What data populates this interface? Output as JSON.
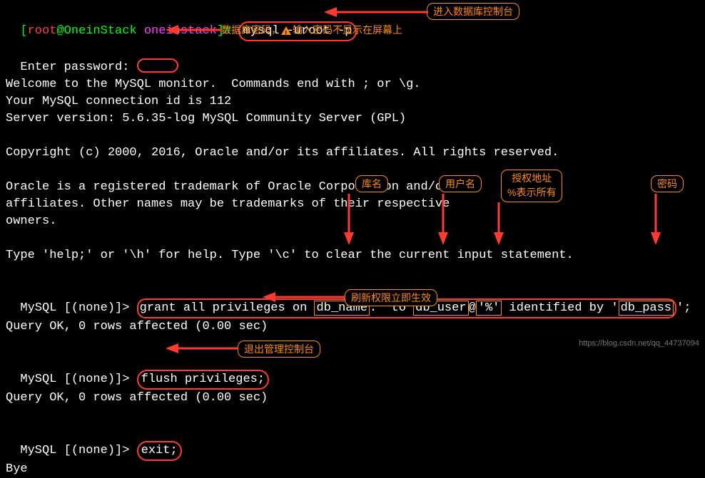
{
  "prompt": {
    "open_bracket": "[",
    "user": "root",
    "at": "@OneinStack ",
    "dir": "oneinstack",
    "close_bracket": "]# ",
    "cmd": "mysql -uroot -p"
  },
  "lines": {
    "enter_password": "Enter password:",
    "welcome": "Welcome to the MySQL monitor.  Commands end with ; or \\g.",
    "conn_id": "Your MySQL connection id is 112",
    "server_ver": "Server version: 5.6.35-log MySQL Community Server (GPL)",
    "copyright": "Copyright (c) 2000, 2016, Oracle and/or its affiliates. All rights reserved.",
    "oracle1": "Oracle is a registered trademark of Oracle Corporation and/or its",
    "oracle2": "affiliates. Other names may be trademarks of their respective",
    "oracle3": "owners.",
    "help": "Type 'help;' or '\\h' for help. Type '\\c' to clear the current input statement.",
    "queryok": "Query OK, 0 rows affected (0.00 sec)",
    "bye": "Bye"
  },
  "mysql_prompt": "MySQL [(none)]> ",
  "grant": {
    "p1": "grant all privileges on ",
    "dbname": "db_name",
    "p2": ".* to ",
    "dbuser": "db_user",
    "at": "@",
    "host": "'%'",
    "p3": " identified by '",
    "dbpass": "db_pass",
    "p4": "';"
  },
  "flush_cmd": "flush privileges;",
  "exit_cmd": "exit;",
  "annotations": {
    "enter_console": "进入数据库控制台",
    "password_note_a": "数据库密码，",
    "password_note_b": "输入密码不显示在屏幕上",
    "dbname": "库名",
    "username": "用户名",
    "grant_host_l1": "授权地址",
    "grant_host_l2": "%表示所有",
    "password": "密码",
    "flush": "刷新权限立即生效",
    "exit": "退出管理控制台"
  },
  "watermark": "https://blog.csdn.net/qq_44737094"
}
